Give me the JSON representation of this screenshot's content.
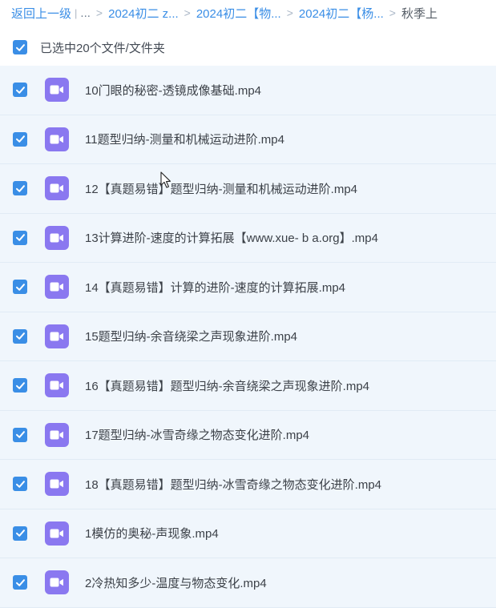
{
  "breadcrumb": {
    "back": "返回上一级",
    "pipe": "|",
    "ellipsis": "...",
    "separator": ">",
    "items": [
      "2024初二 z...",
      "2024初二【物...",
      "2024初二【杨..."
    ],
    "current": "秋季上"
  },
  "selection": {
    "label": "已选中20个文件/文件夹",
    "checked": true
  },
  "files": [
    {
      "name": "10门眼的秘密-透镜成像基础.mp4",
      "checked": true,
      "icon": "video-file-icon"
    },
    {
      "name": "11题型归纳-测量和机械运动进阶.mp4",
      "checked": true,
      "icon": "video-file-icon"
    },
    {
      "name": "12【真题易错】题型归纳-测量和机械运动进阶.mp4",
      "checked": true,
      "icon": "video-file-icon"
    },
    {
      "name": "13计算进阶-速度的计算拓展【www.xue- b a.org】.mp4",
      "checked": true,
      "icon": "video-file-icon"
    },
    {
      "name": "14【真题易错】计算的进阶-速度的计算拓展.mp4",
      "checked": true,
      "icon": "video-file-icon"
    },
    {
      "name": "15题型归纳-余音绕梁之声现象进阶.mp4",
      "checked": true,
      "icon": "video-file-icon"
    },
    {
      "name": "16【真题易错】题型归纳-余音绕梁之声现象进阶.mp4",
      "checked": true,
      "icon": "video-file-icon"
    },
    {
      "name": "17题型归纳-冰雪奇缘之物态变化进阶.mp4",
      "checked": true,
      "icon": "video-file-icon"
    },
    {
      "name": "18【真题易错】题型归纳-冰雪奇缘之物态变化进阶.mp4",
      "checked": true,
      "icon": "video-file-icon"
    },
    {
      "name": "1模仿的奥秘-声现象.mp4",
      "checked": true,
      "icon": "video-file-icon"
    },
    {
      "name": "2冷热知多少-温度与物态变化.mp4",
      "checked": true,
      "icon": "video-file-icon"
    }
  ],
  "colors": {
    "accent": "#3a8ee6",
    "video_icon": "#8a78f0",
    "row_bg": "#f0f6fc"
  }
}
